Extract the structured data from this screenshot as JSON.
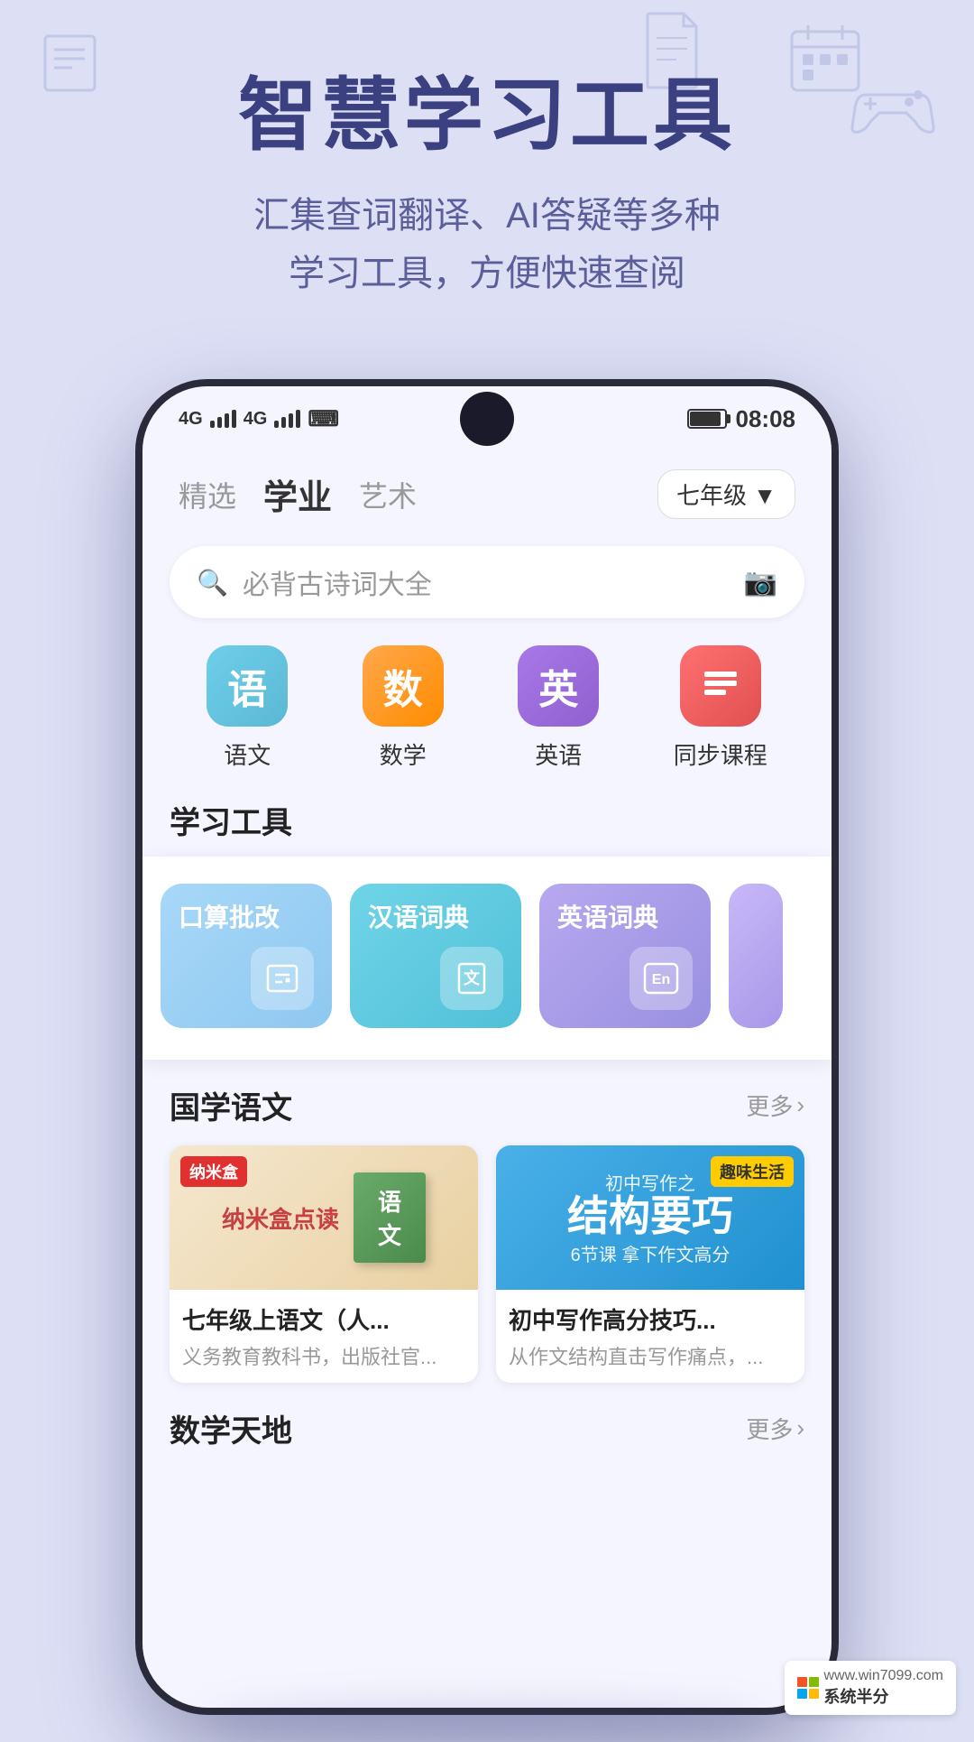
{
  "app": {
    "title": "智慧学习工具",
    "subtitle_line1": "汇集查词翻译、AI答疑等多种",
    "subtitle_line2": "学习工具，方便快速查阅"
  },
  "status_bar": {
    "signal_4g_1": "4G",
    "signal_4g_2": "4G",
    "time": "08:08"
  },
  "tabs": [
    {
      "id": "featured",
      "label": "精选",
      "active": false
    },
    {
      "id": "academic",
      "label": "学业",
      "active": true
    },
    {
      "id": "art",
      "label": "艺术",
      "active": false
    }
  ],
  "grade_selector": "七年级 ▼",
  "search": {
    "placeholder": "必背古诗词大全"
  },
  "subjects": [
    {
      "id": "chinese",
      "label": "语文",
      "icon": "语",
      "color_class": "chinese"
    },
    {
      "id": "math",
      "label": "数学",
      "icon": "数",
      "color_class": "math"
    },
    {
      "id": "english",
      "label": "英语",
      "icon": "英",
      "color_class": "english"
    },
    {
      "id": "sync",
      "label": "同步课程",
      "icon": "≡",
      "color_class": "sync"
    }
  ],
  "tools_section": {
    "title": "学习工具",
    "tools": [
      {
        "id": "oral",
        "label": "口算批改",
        "icon": "⊞",
        "color_class": "oral"
      },
      {
        "id": "chinese_dict",
        "label": "汉语词典",
        "icon": "文",
        "color_class": "chinese-dict"
      },
      {
        "id": "english_dict",
        "label": "英语词典",
        "icon": "En",
        "color_class": "english-dict"
      }
    ]
  },
  "guoxue_section": {
    "title": "国学语文",
    "more_label": "更多",
    "courses": [
      {
        "id": "course1",
        "badge": "纳米盒",
        "title": "七年级上语文（人...",
        "desc": "义务教育教科书，出版社官...",
        "sub_text": "纳米盒点读"
      },
      {
        "id": "course2",
        "badge": "趣味生活",
        "title": "初中写作高分技巧...",
        "desc": "从作文结构直击写作痛点，...",
        "main_text": "结构要巧",
        "sub_desc": "6节课 拿下作文高分",
        "pre_text": "初中写作之"
      }
    ]
  },
  "math_section": {
    "title": "数学天地",
    "more_label": "更多"
  },
  "watermark": {
    "site": "www.win7099.com",
    "score": "系统半分"
  }
}
